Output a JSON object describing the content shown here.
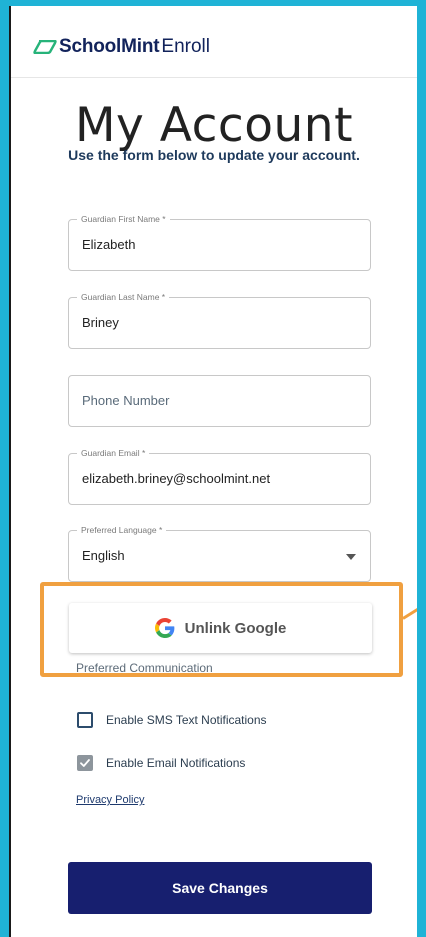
{
  "app": {
    "brand": "SchoolMint",
    "product": "Enroll"
  },
  "page": {
    "title": "My Account",
    "subtitle": "Use the form below to update your account."
  },
  "form": {
    "first_name": {
      "label": "Guardian First Name *",
      "value": "Elizabeth"
    },
    "last_name": {
      "label": "Guardian Last Name *",
      "value": "Briney"
    },
    "phone": {
      "placeholder": "Phone Number"
    },
    "email": {
      "label": "Guardian Email *",
      "value": "elizabeth.briney@schoolmint.net"
    },
    "language": {
      "label": "Preferred Language *",
      "value": "English"
    },
    "google_button": "Unlink Google",
    "communication": {
      "title": "Preferred Communication",
      "sms": {
        "label": "Enable SMS Text Notifications",
        "checked": false
      },
      "email": {
        "label": "Enable Email Notifications",
        "checked": true
      }
    },
    "privacy_link": "Privacy Policy",
    "save_button": "Save Changes"
  },
  "colors": {
    "brand_navy": "#171f6f",
    "highlight": "#f0a040",
    "outer_bg": "#1fb3d6"
  }
}
